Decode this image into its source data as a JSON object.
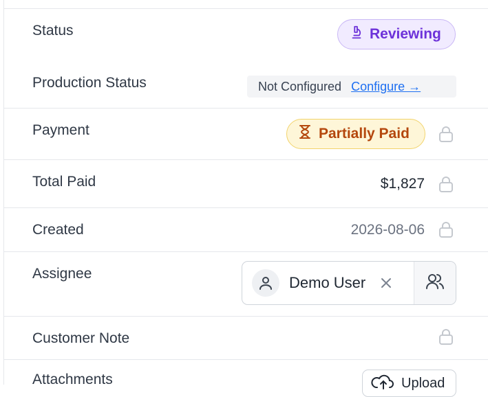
{
  "fields": {
    "status": {
      "label": "Status",
      "value": "Reviewing"
    },
    "production_status": {
      "label": "Production Status",
      "value": "Not Configured",
      "link": "Configure →"
    },
    "payment": {
      "label": "Payment",
      "value": "Partially Paid"
    },
    "total_paid": {
      "label": "Total Paid",
      "value": "$1,827"
    },
    "created": {
      "label": "Created",
      "value": "2026-08-06"
    },
    "assignee": {
      "label": "Assignee",
      "value": "Demo User"
    },
    "customer_note": {
      "label": "Customer Note"
    },
    "attachments": {
      "label": "Attachments",
      "button": "Upload"
    }
  },
  "colors": {
    "reviewing_text": "#6d32d9",
    "reviewing_bg": "#f1ebff",
    "partial_text": "#b4470d",
    "partial_bg": "#fef6d8",
    "link": "#1d6ff2",
    "lock": "#c4c8ce"
  },
  "icons": {
    "status": "reviewing-icon",
    "payment": "hourglass-icon",
    "lock": "lock-icon",
    "avatar": "user-icon",
    "clear": "close-icon",
    "assignee_picker": "users-icon",
    "upload": "cloud-upload-icon"
  }
}
